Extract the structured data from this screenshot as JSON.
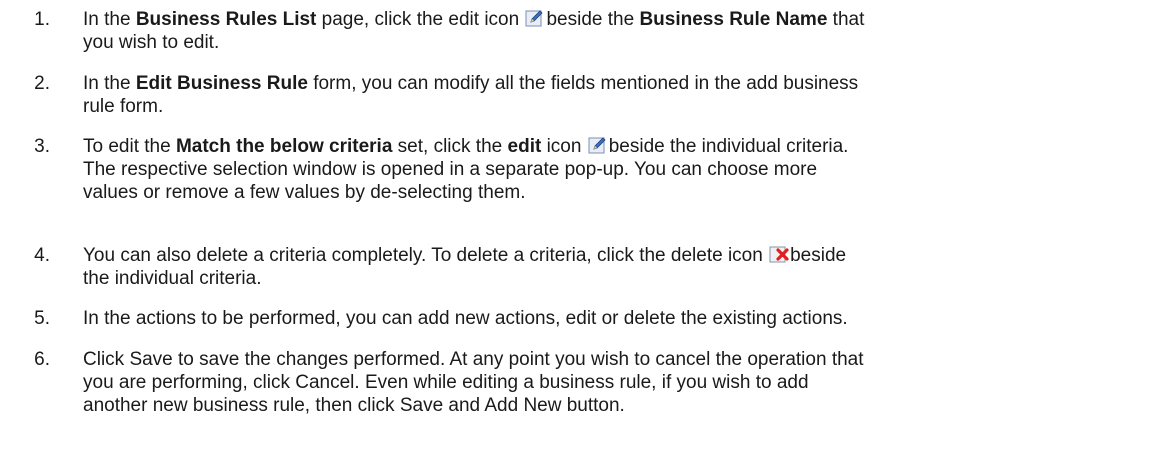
{
  "steps": [
    {
      "number": "1.",
      "parts": [
        "In the ",
        "Business Rules List",
        " page, click the edit icon ",
        "beside the ",
        "Business Rule Name",
        " that",
        "you wish to edit."
      ]
    },
    {
      "number": "2.",
      "parts": [
        "In the ",
        "Edit Business Rule",
        " form, you can modify all the fields mentioned in the add business",
        "rule form."
      ]
    },
    {
      "number": "3.",
      "parts": [
        "To edit the ",
        "Match the below criteria",
        " set, click the ",
        "edit",
        " icon ",
        "beside the individual criteria.",
        "The respective selection window is opened in a separate pop-up. You can choose more",
        "values or remove a few values by de-selecting them."
      ]
    },
    {
      "number": "4.",
      "parts": [
        "You can also delete a criteria completely. To delete a criteria, click the delete icon ",
        "beside",
        "the individual criteria."
      ]
    },
    {
      "number": "5.",
      "parts": [
        "In the actions to be performed, you can add new actions, edit or delete the existing actions."
      ]
    },
    {
      "number": "6.",
      "parts": [
        "Click Save to save the changes performed. At any point you wish to cancel the operation that",
        "you are performing, click Cancel. Even while editing a business rule, if you wish to add",
        "another new business rule, then click Save and Add New button."
      ]
    }
  ],
  "icons": {
    "edit": "edit-icon",
    "delete": "delete-icon"
  }
}
